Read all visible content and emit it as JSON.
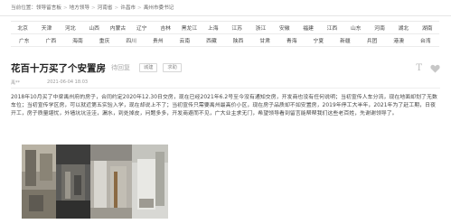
{
  "breadcrumb": {
    "prefix": "当前位置：",
    "items": [
      "领导留言板",
      "地方领导",
      "河南省",
      "许昌市",
      "禹州市委书记"
    ]
  },
  "regions": [
    [
      "北京",
      "天津",
      "河北",
      "山西",
      "内蒙古",
      "辽宁",
      "吉林",
      "黑龙江",
      "上海",
      "江苏",
      "浙江",
      "安徽",
      "福建",
      "江西",
      "山东",
      "河南",
      "湖北",
      "湖南"
    ],
    [
      "广东",
      "广西",
      "海南",
      "重庆",
      "四川",
      "贵州",
      "云南",
      "西藏",
      "陕西",
      "甘肃",
      "青海",
      "宁夏",
      "新疆",
      "兵团",
      "港澳",
      "台湾"
    ]
  ],
  "post": {
    "title": "花百十万买了个安置房",
    "status": "待回复",
    "tags": [
      "城建",
      "求助"
    ],
    "author": "禹**",
    "time": "2021-06-04 18:03",
    "content": "2018年10月买了中梁禹州府的房子，合同约定2020年12.30日交房，现在已经2021年6.2号至今没有通知交房，开发商也没有任何说明；当初宣传人车分流，现在地面却划了无数车位；当初宣传学区房，可以就近第五实验入学，现在却说上不了；当初宣传只需要禹州最高价小区，现在房子品质却不如安置房，2019年停工大半年，2021年为了赶工期，日夜开工，房子质量堪忧，外墙坑坑洼洼，漏水，到处掉皮，问题多多，开发商避而不见，广大业主求无门，希望领导看到留言能帮帮我们这些老百姓，先谢谢领导了。"
  },
  "icons": {
    "text_size": "T",
    "like": "heart-icon"
  }
}
